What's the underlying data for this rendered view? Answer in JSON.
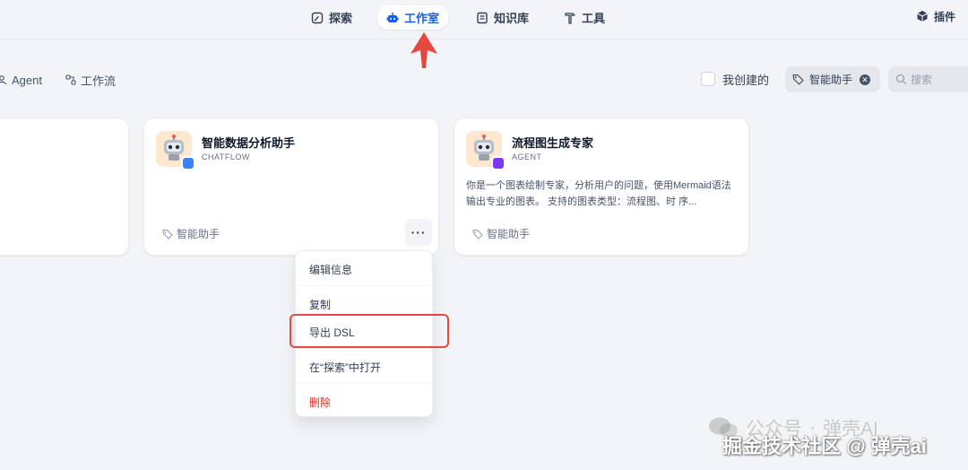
{
  "nav": {
    "items": [
      {
        "label": "探索",
        "icon": "compass-icon"
      },
      {
        "label": "工作室",
        "icon": "robot-icon",
        "active": true
      },
      {
        "label": "知识库",
        "icon": "book-icon"
      },
      {
        "label": "工具",
        "icon": "hammer-icon"
      }
    ],
    "plugin_label": "插件"
  },
  "filters": {
    "tab_agent": "Agent",
    "tab_workflow": "工作流",
    "created_by_me": "我创建的",
    "tag_filter": "智能助手",
    "search_placeholder": "搜索"
  },
  "cards": [
    {
      "title": "智能数据分析助手",
      "type": "CHATFLOW",
      "description": "",
      "tag": "智能助手",
      "more": "···"
    },
    {
      "title": "流程图生成专家",
      "type": "AGENT",
      "description": "你是一个图表绘制专家，分析用户的问题，使用Mermaid语法输出专业的图表。 支持的图表类型：流程图、时 序...",
      "tag": "智能助手"
    }
  ],
  "menu": {
    "edit_info": "编辑信息",
    "copy": "复制",
    "export_dsl": "导出 DSL",
    "open_in_explore": "在“探索”中打开",
    "delete": "删除"
  },
  "watermark": {
    "line1_prefix": "公众号",
    "line1_name": "弹壳AI",
    "line2": "掘金技术社区 @ 弹壳ai"
  },
  "colors": {
    "accent": "#155eef",
    "danger": "#d92d20",
    "annotation_red": "#e5483c",
    "icon_bg": "#fde7cf",
    "chatflow_badge": "#3b82f6",
    "agent_badge": "#7c3aed"
  }
}
